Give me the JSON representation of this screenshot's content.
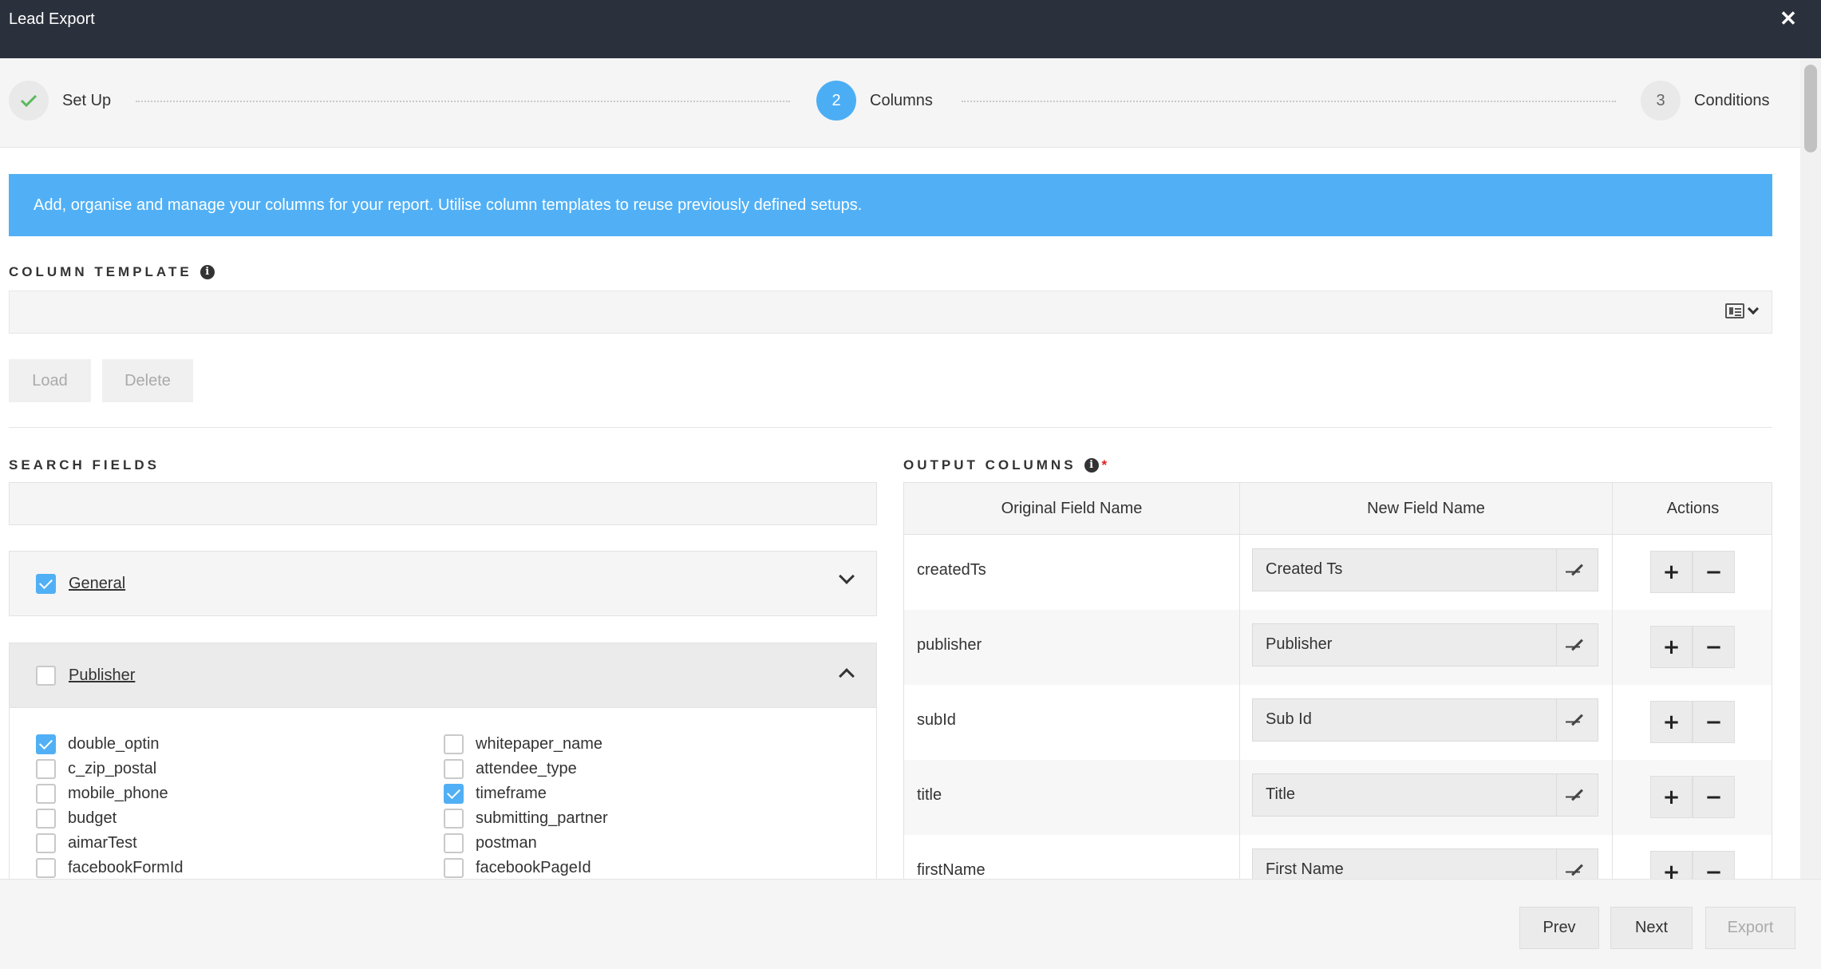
{
  "window": {
    "title": "Lead Export",
    "close_glyph": "✕"
  },
  "stepper": {
    "steps": [
      {
        "number": "",
        "label": "Set Up",
        "state": "done"
      },
      {
        "number": "2",
        "label": "Columns",
        "state": "active"
      },
      {
        "number": "3",
        "label": "Conditions",
        "state": "todo"
      }
    ]
  },
  "banner": {
    "text": "Add, organise and manage your columns for your report. Utilise column templates to reuse previously defined setups."
  },
  "column_template": {
    "label": "COLUMN TEMPLATE",
    "value": "",
    "load_label": "Load",
    "delete_label": "Delete"
  },
  "search_fields": {
    "label": "SEARCH FIELDS",
    "value": "",
    "groups": [
      {
        "name": "General",
        "checked": true,
        "expanded": false
      },
      {
        "name": "Publisher",
        "checked": false,
        "expanded": true
      }
    ],
    "fields_left": [
      {
        "name": "double_optin",
        "checked": true
      },
      {
        "name": "c_zip_postal",
        "checked": false
      },
      {
        "name": "mobile_phone",
        "checked": false
      },
      {
        "name": "budget",
        "checked": false
      },
      {
        "name": "aimarTest",
        "checked": false
      },
      {
        "name": "facebookFormId",
        "checked": false
      }
    ],
    "fields_right": [
      {
        "name": "whitepaper_name",
        "checked": false
      },
      {
        "name": "attendee_type",
        "checked": false
      },
      {
        "name": "timeframe",
        "checked": true
      },
      {
        "name": "submitting_partner",
        "checked": false
      },
      {
        "name": "postman",
        "checked": false
      },
      {
        "name": "facebookPageId",
        "checked": false
      }
    ]
  },
  "output_columns": {
    "label": "OUTPUT COLUMNS",
    "required_mark": "*",
    "headers": {
      "original": "Original Field Name",
      "new": "New Field Name",
      "actions": "Actions"
    },
    "rows": [
      {
        "original": "createdTs",
        "new": "Created Ts"
      },
      {
        "original": "publisher",
        "new": "Publisher"
      },
      {
        "original": "subId",
        "new": "Sub Id"
      },
      {
        "original": "title",
        "new": "Title"
      },
      {
        "original": "firstName",
        "new": "First Name"
      }
    ],
    "add_glyph": "+",
    "remove_glyph": "−"
  },
  "footer": {
    "prev_label": "Prev",
    "next_label": "Next",
    "export_label": "Export"
  },
  "colors": {
    "header_bg": "#2b313c",
    "accent": "#4baef5",
    "banner_bg": "#51b0f5",
    "success": "#5cb85c"
  }
}
